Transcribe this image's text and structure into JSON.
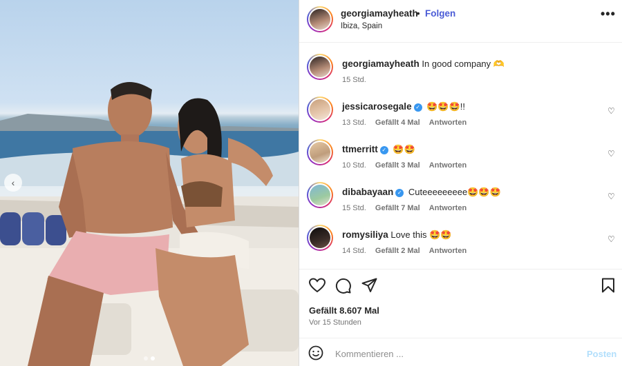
{
  "post": {
    "author": "georgiamayheath",
    "follow_label": "Folgen",
    "separator": "•",
    "location": "Ibiza, Spain",
    "more_label": "•••",
    "caption": {
      "username": "georgiamayheath",
      "text": "In good company 🫶",
      "time": "15 Std."
    }
  },
  "carousel": {
    "prev_icon": "chevron-left-icon",
    "slide_count": 2,
    "active_slide": 2
  },
  "comments": [
    {
      "username": "jessicarosegale",
      "verified": true,
      "text": "🤩🤩🤩!!",
      "time": "13 Std.",
      "likes": "Gefällt 4 Mal",
      "reply": "Antworten"
    },
    {
      "username": "ttmerritt",
      "verified": true,
      "text": "🤩🤩",
      "time": "10 Std.",
      "likes": "Gefällt 3 Mal",
      "reply": "Antworten"
    },
    {
      "username": "dibabayaan",
      "verified": true,
      "text": "Cuteeeeeeeee🤩🤩🤩",
      "time": "15 Std.",
      "likes": "Gefällt 7 Mal",
      "reply": "Antworten"
    },
    {
      "username": "romysiliya",
      "verified": false,
      "text": "Love this 🤩🤩",
      "time": "14 Std.",
      "likes": "Gefällt 2 Mal",
      "reply": "Antworten"
    }
  ],
  "footer": {
    "likes": "Gefällt 8.607 Mal",
    "posted": "Vor 15 Stunden",
    "comment_placeholder": "Kommentieren ...",
    "post_label": "Posten"
  },
  "colors": {
    "follow": "#4a5bd6",
    "verified": "#3897f0",
    "post_disabled": "#b2dffc"
  }
}
